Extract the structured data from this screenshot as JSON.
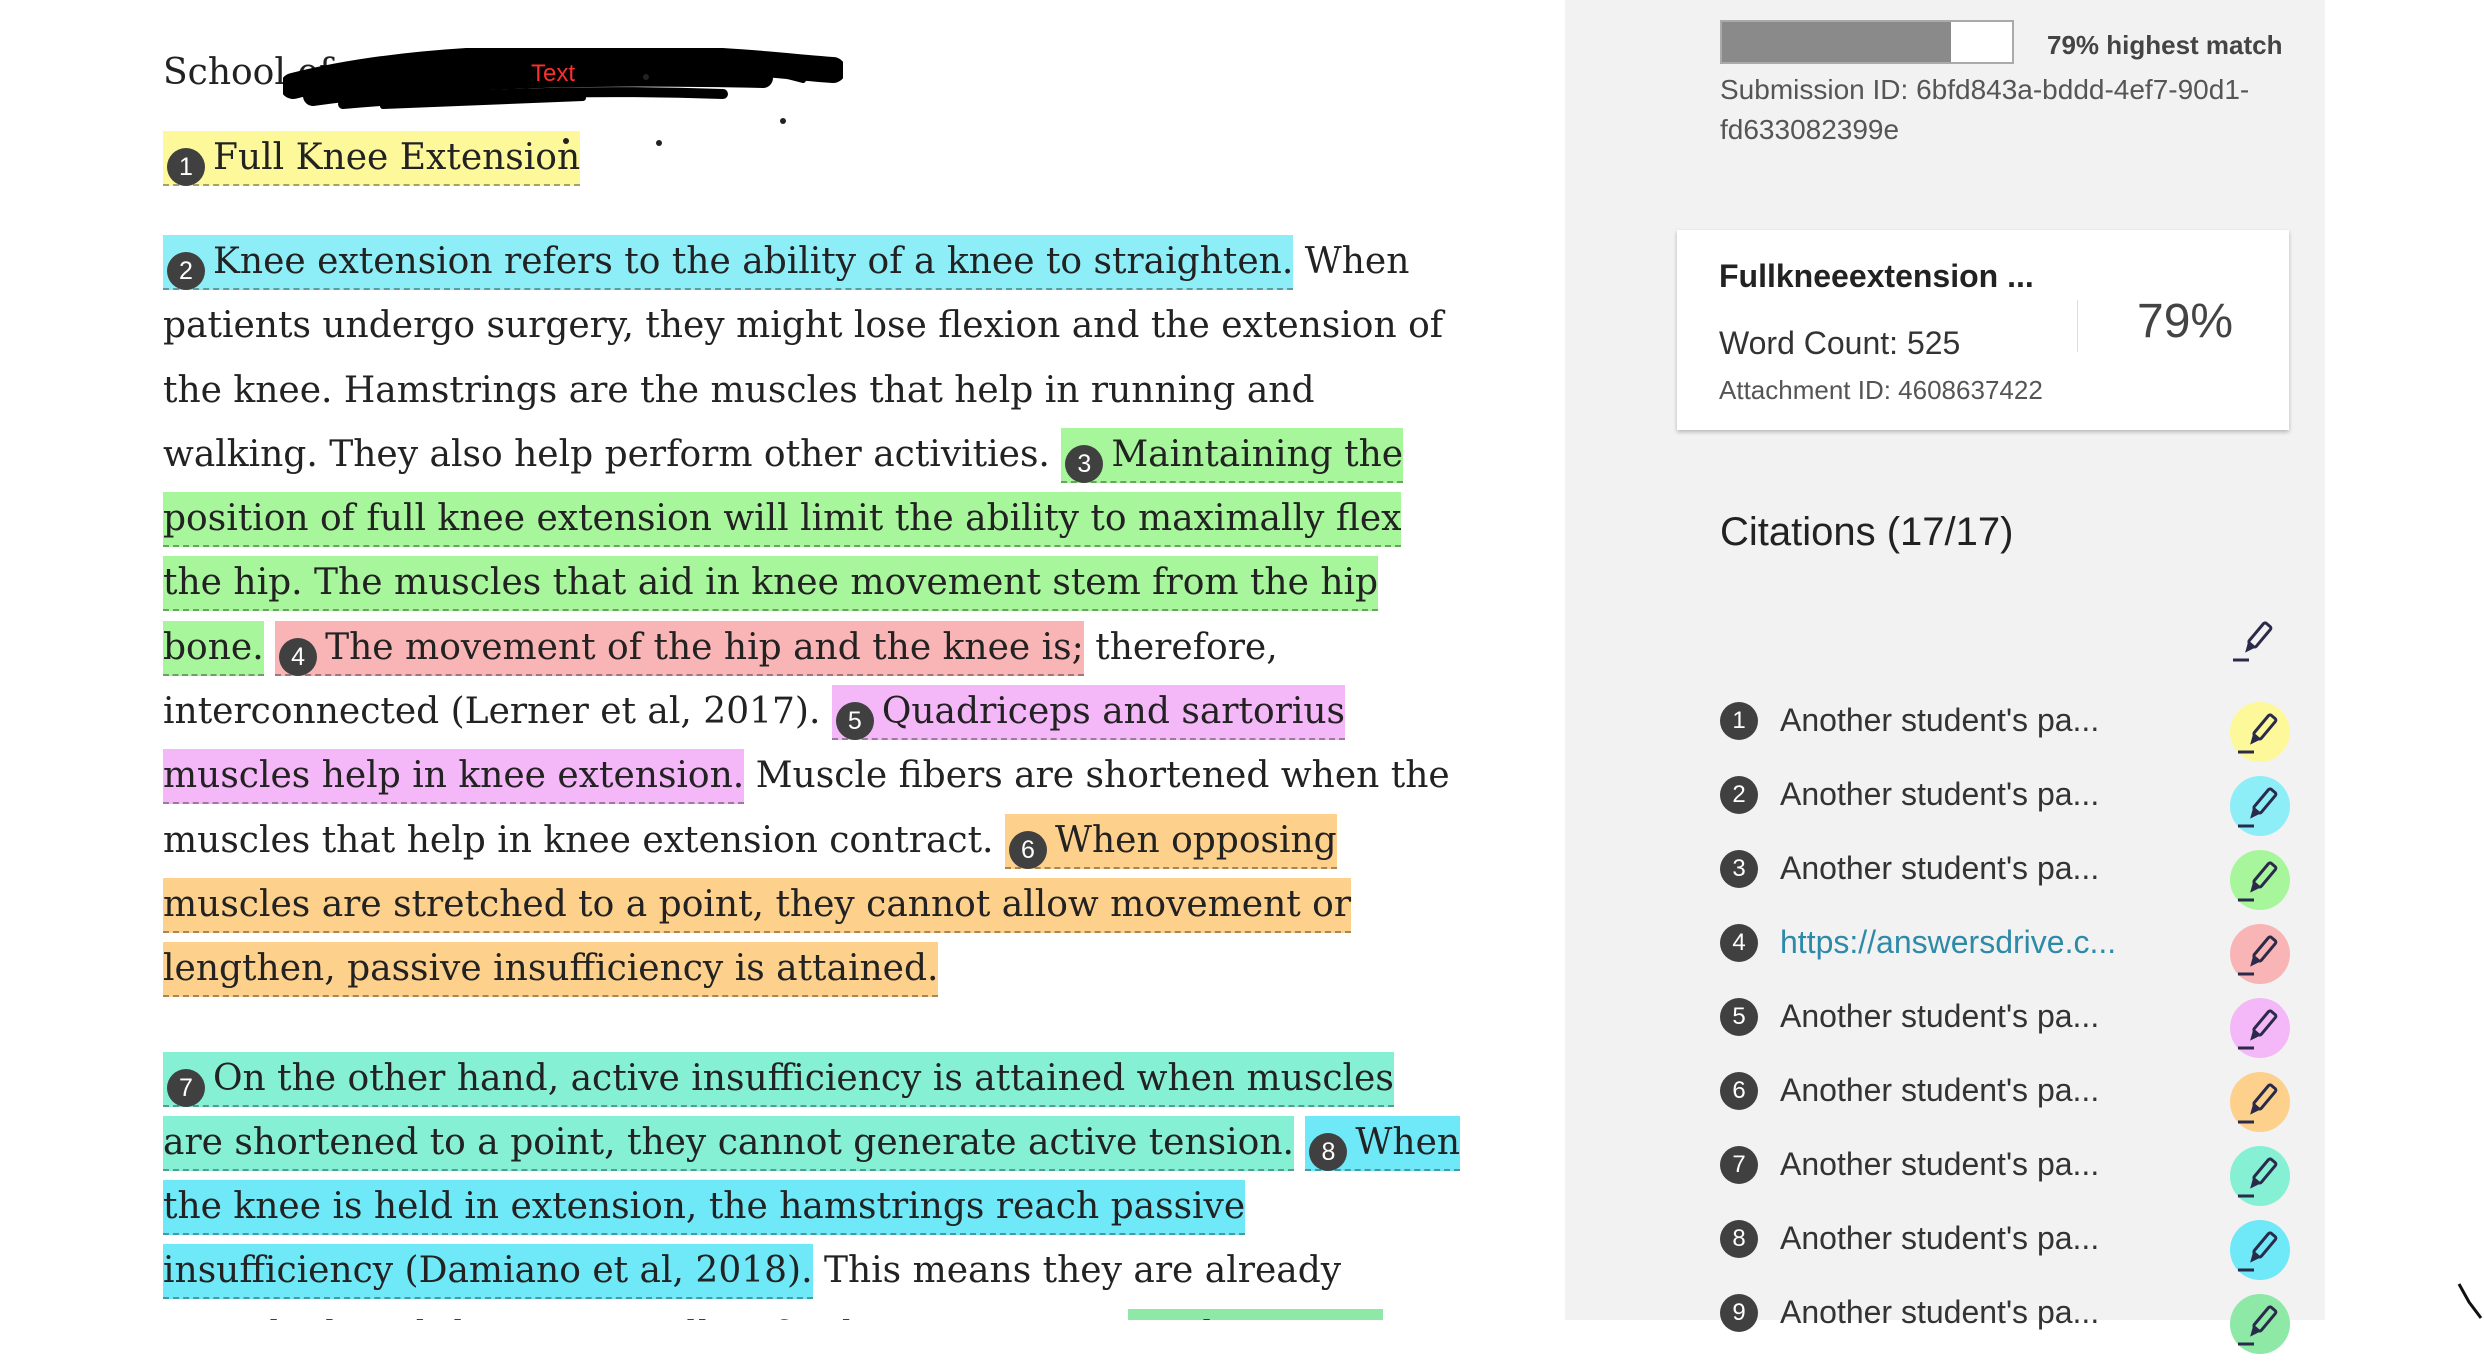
{
  "document": {
    "header_prefix": "School of",
    "redaction_label": "Text",
    "title": "Full Knee Extension",
    "paragraphs": [
      [
        {
          "num": "2",
          "color": "c2",
          "text": "Knee extension refers to the ability of a knee to straighten."
        },
        {
          "text": " When patients undergo surgery, they might lose flexion and the extension of the knee. Hamstrings are the muscles that help in running and walking. They also help perform other activities. "
        },
        {
          "num": "3",
          "color": "c3",
          "text": "Maintaining the position of full knee extension will limit the ability to maximally flex the hip.  The muscles that aid in knee movement stem from the hip bone."
        },
        {
          "text": " "
        },
        {
          "num": "4",
          "color": "c4",
          "text": "The movement of the hip and the knee is;"
        },
        {
          "text": " therefore, interconnected (Lerner et al, 2017). "
        },
        {
          "num": "5",
          "color": "c5",
          "text": "Quadriceps and sartorius muscles help in knee extension."
        },
        {
          "text": " Muscle fibers are shortened when the muscles that help in knee extension contract. "
        },
        {
          "num": "6",
          "color": "c6",
          "text": "When opposing muscles are stretched to a point, they cannot allow movement or lengthen, passive insufficiency is attained."
        }
      ],
      [
        {
          "num": "7",
          "color": "c7",
          "text": "On the other hand, active insufficiency is attained when muscles are shortened to a point, they cannot generate active tension."
        },
        {
          "text": " "
        },
        {
          "num": "8",
          "color": "c8",
          "text": "When the knee is held in extension, the hamstrings reach passive insufficiency (Damiano et al, 2018)."
        },
        {
          "text": " This means they are already stretched, and they cannot allow further movement. "
        },
        {
          "num": "9",
          "color": "c9",
          "text": "The Rectus femoris also reaches active"
        }
      ]
    ]
  },
  "panel": {
    "match_fraction": 0.79,
    "match_label": "79% highest match",
    "submission_id": "Submission ID: 6bfd843a-bddd-4ef7-90d1-fd633082399e",
    "card": {
      "title": "Fullkneeextension ...",
      "word_count": "Word Count: 525",
      "attachment_id": "Attachment ID: 4608637422",
      "percent": "79%"
    },
    "citations_title": "Citations (17/17)",
    "citations": [
      {
        "num": "1",
        "label": "Another student's pa...",
        "color": "#fdf99b",
        "link": false
      },
      {
        "num": "2",
        "label": "Another student's pa...",
        "color": "#8eeef8",
        "link": false
      },
      {
        "num": "3",
        "label": "Another student's pa...",
        "color": "#a8f69b",
        "link": false
      },
      {
        "num": "4",
        "label": "https://answersdrive.c...",
        "color": "#f9b5b5",
        "link": true
      },
      {
        "num": "5",
        "label": "Another student's pa...",
        "color": "#f4b8f8",
        "link": false
      },
      {
        "num": "6",
        "label": "Another student's pa...",
        "color": "#fdd08c",
        "link": false
      },
      {
        "num": "7",
        "label": "Another student's pa...",
        "color": "#85f0d4",
        "link": false
      },
      {
        "num": "8",
        "label": "Another student's pa...",
        "color": "#6fe8f8",
        "link": false
      },
      {
        "num": "9",
        "label": "Another student's pa...",
        "color": "#8ee8a6",
        "link": false
      }
    ],
    "icons": {
      "toggle": "highlighter-pen-icon"
    }
  }
}
